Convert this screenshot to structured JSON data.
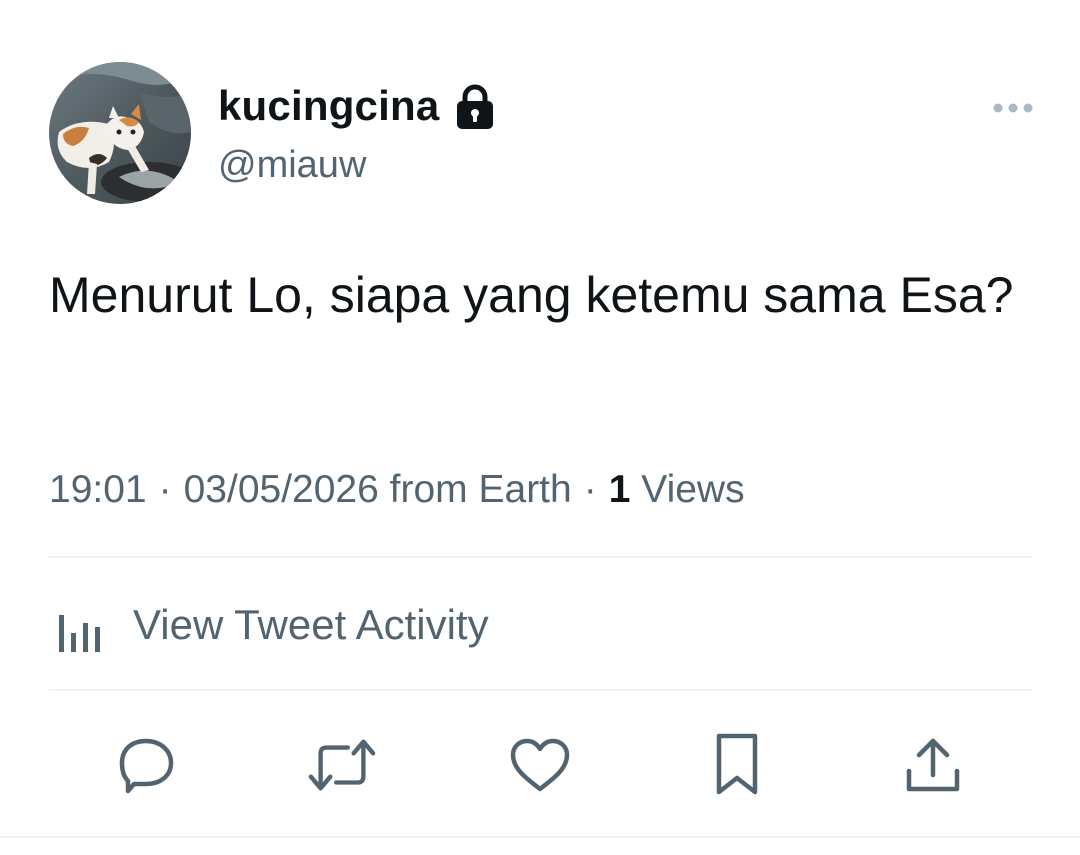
{
  "author": {
    "display_name": "kucingcina",
    "handle": "@miauw",
    "protected": true,
    "avatar_icon": "cat-photo-avatar"
  },
  "tweet": {
    "text": "Menurut Lo, siapa yang ketemu sama Esa?"
  },
  "meta": {
    "time": "19:01",
    "separator": "·",
    "date": "03/05/2026",
    "source": "from Earth",
    "views_count": "1",
    "views_label": "Views"
  },
  "activity": {
    "label": "View Tweet Activity",
    "icon": "bar-chart-icon"
  },
  "actions": [
    {
      "name": "reply",
      "icon": "reply-icon"
    },
    {
      "name": "retweet",
      "icon": "retweet-icon"
    },
    {
      "name": "like",
      "icon": "heart-icon"
    },
    {
      "name": "bookmark",
      "icon": "bookmark-icon"
    },
    {
      "name": "share",
      "icon": "share-icon"
    }
  ],
  "colors": {
    "primary_text": "#0f1419",
    "secondary_text": "#536471",
    "divider": "#eff3f4",
    "background": "#ffffff"
  }
}
